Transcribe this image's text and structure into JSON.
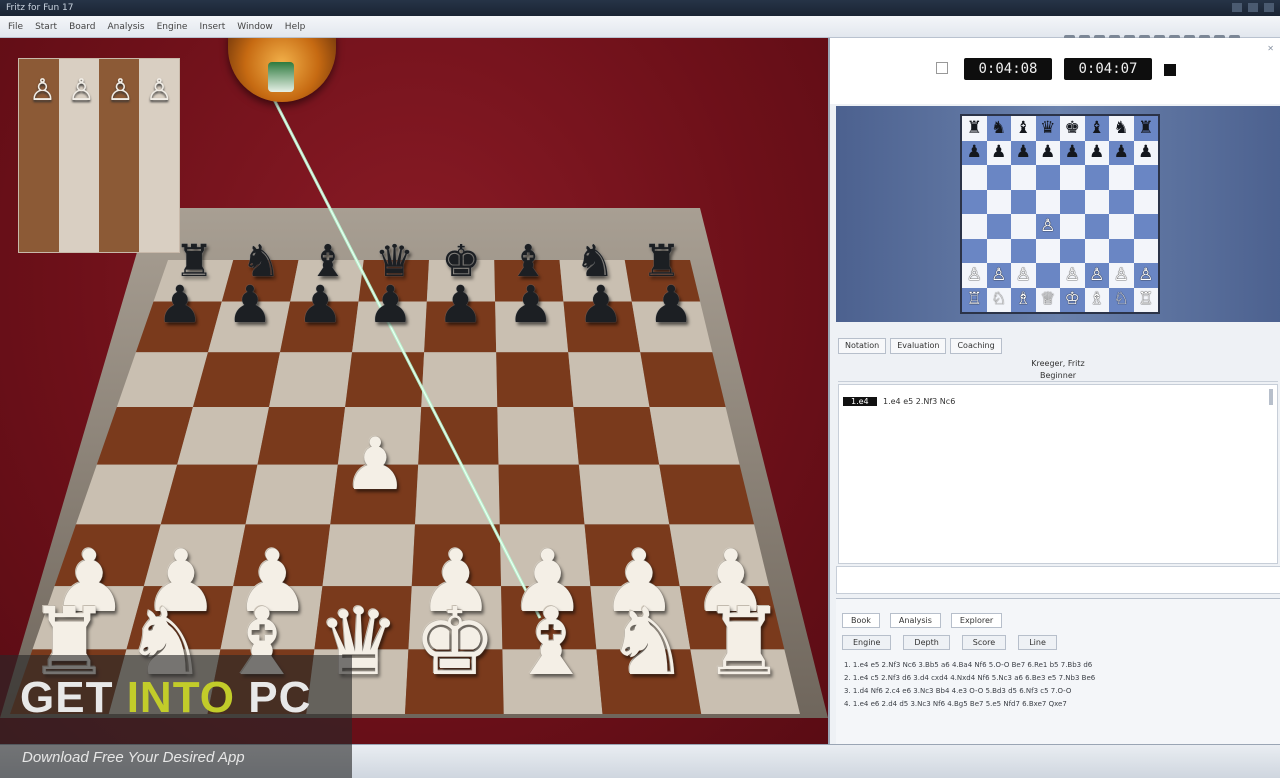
{
  "window": {
    "title": "Fritz for Fun 17",
    "menus": [
      "File",
      "Start",
      "Board",
      "Analysis",
      "Engine",
      "Insert",
      "Window",
      "Help"
    ]
  },
  "clocks": {
    "white": "0:04:08",
    "black": "0:04:07"
  },
  "notation": {
    "tabs": [
      "Notation",
      "Evaluation",
      "Coaching"
    ],
    "header_line1": "Kreeger, Fritz",
    "header_line2": "Beginner",
    "first_move_tag": "1.e4",
    "moves_text": "1.e4 e5 2.Nf3 Nc6"
  },
  "book": {
    "tabs": [
      "Book",
      "Analysis",
      "Explorer"
    ],
    "columns": [
      "Engine",
      "Depth",
      "Score",
      "Line"
    ],
    "lines": [
      "1. 1.e4 e5 2.Nf3 Nc6 3.Bb5 a6 4.Ba4 Nf6 5.O-O Be7 6.Re1 b5 7.Bb3 d6",
      "2. 1.e4 c5 2.Nf3 d6 3.d4 cxd4 4.Nxd4 Nf6 5.Nc3 a6 6.Be3 e5 7.Nb3 Be6",
      "3. 1.d4 Nf6 2.c4 e6 3.Nc3 Bb4 4.e3 O-O 5.Bd3 d5 6.Nf3 c5 7.O-O",
      "4. 1.e4 e6 2.d4 d5 3.Nc3 Nf6 4.Bg5 Be7 5.e5 Nfd7 6.Bxe7 Qxe7"
    ]
  },
  "watermark": {
    "brand_get": "GET ",
    "brand_into": "INTO",
    "brand_pc": " PC",
    "tagline": "Download Free Your Desired App"
  },
  "board_2d": {
    "rows": [
      [
        "♜",
        "♞",
        "♝",
        "♛",
        "♚",
        "♝",
        "♞",
        "♜"
      ],
      [
        "♟",
        "♟",
        "♟",
        "♟",
        "♟",
        "♟",
        "♟",
        "♟"
      ],
      [
        "",
        "",
        "",
        "",
        "",
        "",
        "",
        ""
      ],
      [
        "",
        "",
        "",
        "",
        "",
        "",
        "",
        ""
      ],
      [
        "",
        "",
        "",
        "♙",
        "",
        "",
        "",
        ""
      ],
      [
        "",
        "",
        "",
        "",
        "",
        "",
        "",
        ""
      ],
      [
        "♙",
        "♙",
        "♙",
        "",
        "♙",
        "♙",
        "♙",
        "♙"
      ],
      [
        "♖",
        "♘",
        "♗",
        "♕",
        "♔",
        "♗",
        "♘",
        "♖"
      ]
    ]
  },
  "colors": {
    "backdrop": "#6d1019",
    "board_dark": "#7a3a1c",
    "board_light": "#c9bfb1",
    "board_2d_dark": "#6a86c4",
    "board_2d_light": "#f3f5fa",
    "watermark_accent": "#c2cc2a",
    "laser": "#b8ffd6"
  }
}
